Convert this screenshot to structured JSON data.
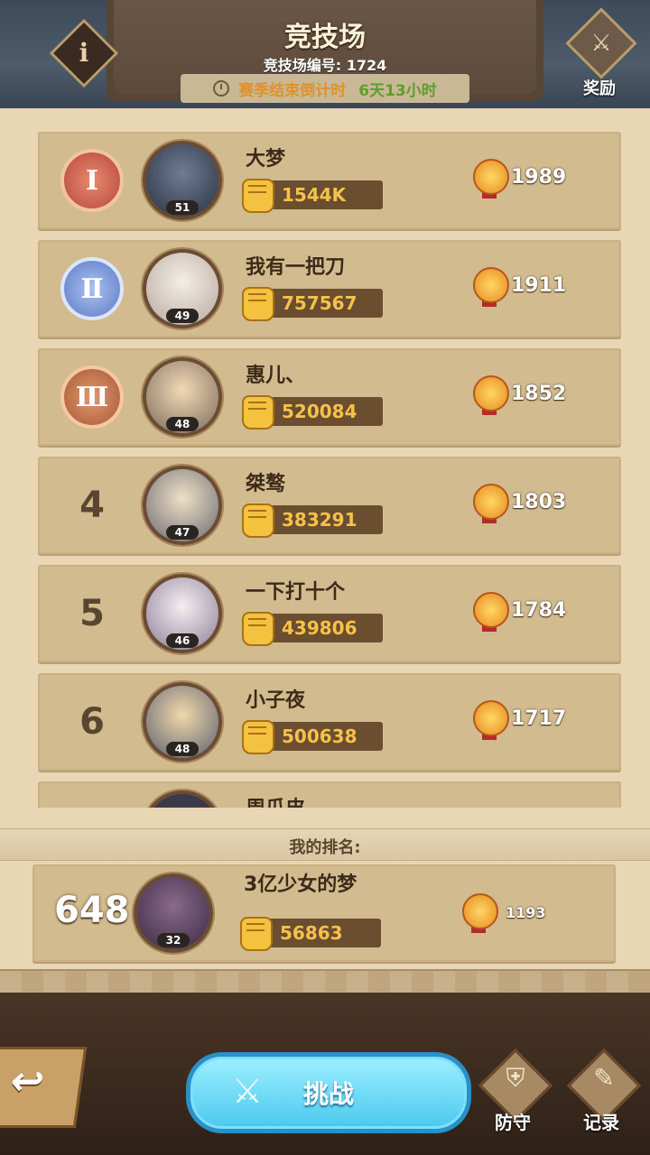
{
  "header": {
    "title": "竞技场",
    "arena_id": "竞技场编号: 1724",
    "season_label": "赛季结束倒计时",
    "season_time": "6天13小时",
    "reward_label": "奖励",
    "info_symbol": "i"
  },
  "leaderboard": [
    {
      "rank": "Ⅰ",
      "medal": "gold",
      "name": "大梦",
      "level": "51",
      "power": "1544K",
      "score": "1989"
    },
    {
      "rank": "Ⅱ",
      "medal": "silver",
      "name": "我有一把刀",
      "level": "49",
      "power": "757567",
      "score": "1911"
    },
    {
      "rank": "Ⅲ",
      "medal": "bronze",
      "name": "惠儿、",
      "level": "48",
      "power": "520084",
      "score": "1852"
    },
    {
      "rank": "4",
      "name": "桀骜",
      "level": "47",
      "power": "383291",
      "score": "1803"
    },
    {
      "rank": "5",
      "name": "一下打十个",
      "level": "46",
      "power": "439806",
      "score": "1784"
    },
    {
      "rank": "6",
      "name": "小子夜",
      "level": "48",
      "power": "500638",
      "score": "1717"
    },
    {
      "name": "周瓜皮"
    }
  ],
  "my_rank": {
    "band_label": "我的排名:",
    "rank": "648",
    "name": "3亿少女的梦",
    "level": "32",
    "power": "56863",
    "score": "1193"
  },
  "bottom_bar": {
    "back_symbol": "↩",
    "challenge_label": "挑战",
    "defense_label": "防守",
    "record_label": "记录"
  },
  "colors": {
    "parchment": "#e8d6b4",
    "row_bg": "#d2bb8e",
    "power_text": "#f5c24a",
    "season_label": "#e0922a",
    "season_time": "#5f9e28",
    "challenge_button": "#4ac8ee"
  },
  "icons": [
    "info-icon",
    "reward-shield-icon",
    "clock-icon",
    "fist-icon",
    "trophy-medal-icon",
    "back-arrow-icon",
    "crossed-swords-icon",
    "shield-icon",
    "scroll-icon"
  ]
}
